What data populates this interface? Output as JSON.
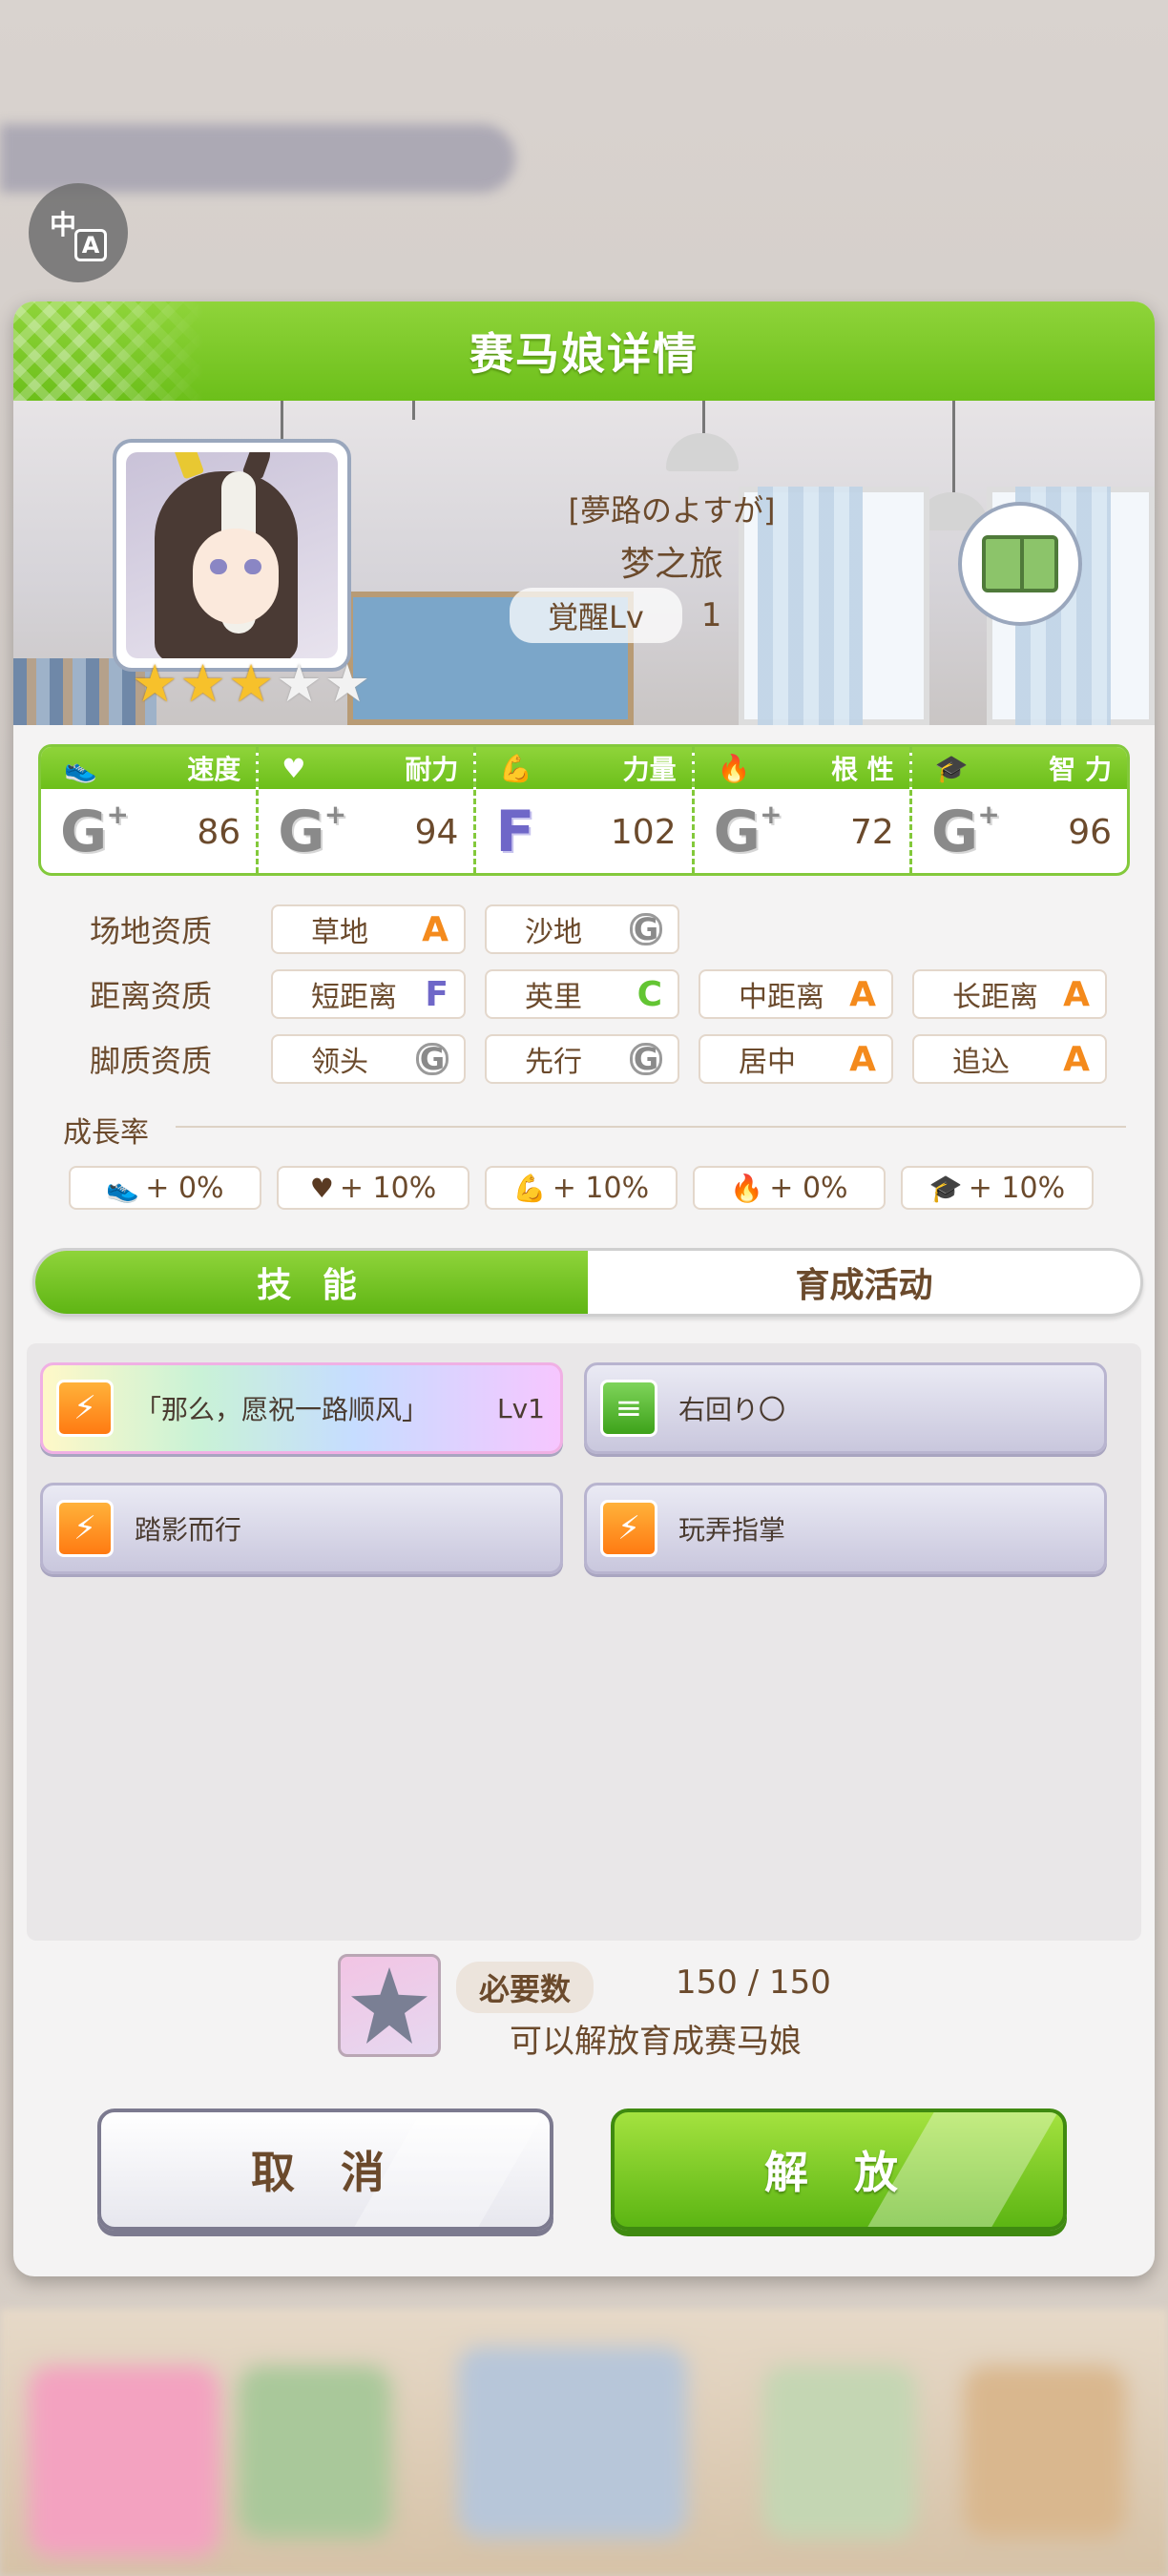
{
  "translate_button": {
    "char_a": "中",
    "char_b": "A"
  },
  "dialog": {
    "title": "赛马娘详情",
    "character": {
      "epithet": "[夢路のよすが]",
      "name": "梦之旅",
      "awakening_label": "覚醒Lv",
      "awakening_level": "1",
      "stars_filled": 3,
      "stars_total": 5
    },
    "stats": [
      {
        "label": "速度",
        "icon": "shoe-icon",
        "grade": "G",
        "value": "86"
      },
      {
        "label": "耐力",
        "icon": "heart-icon",
        "grade": "G",
        "value": "94"
      },
      {
        "label": "力量",
        "icon": "muscle-icon",
        "grade": "F",
        "value": "102"
      },
      {
        "label": "根 性",
        "icon": "fire-icon",
        "grade": "G",
        "value": "72"
      },
      {
        "label": "智 力",
        "icon": "graduation-cap-icon",
        "grade": "G",
        "value": "96"
      }
    ],
    "aptitude": {
      "track": {
        "label": "场地资质",
        "items": [
          {
            "name": "草地",
            "grade": "A"
          },
          {
            "name": "沙地",
            "grade": "G"
          }
        ]
      },
      "distance": {
        "label": "距离资质",
        "items": [
          {
            "name": "短距离",
            "grade": "F"
          },
          {
            "name": "英里",
            "grade": "C"
          },
          {
            "name": "中距离",
            "grade": "A"
          },
          {
            "name": "长距离",
            "grade": "A"
          }
        ]
      },
      "style": {
        "label": "脚质资质",
        "items": [
          {
            "name": "领头",
            "grade": "G"
          },
          {
            "name": "先行",
            "grade": "G"
          },
          {
            "name": "居中",
            "grade": "A"
          },
          {
            "name": "追込",
            "grade": "A"
          }
        ]
      }
    },
    "growth": {
      "title": "成長率",
      "items": [
        {
          "icon": "shoe-icon",
          "value": "+ 0%"
        },
        {
          "icon": "heart-icon",
          "value": "+ 10%"
        },
        {
          "icon": "muscle-icon",
          "value": "+ 10%"
        },
        {
          "icon": "fire-icon",
          "value": "+ 0%"
        },
        {
          "icon": "graduation-cap-icon",
          "value": "+ 10%"
        }
      ]
    },
    "tabs": {
      "skills": "技 能",
      "training": "育成活动"
    },
    "skills": [
      {
        "name": "「那么，愿祝一路顺风」",
        "level": "Lv1",
        "icon_color": "orange"
      },
      {
        "name": "右回り〇",
        "level": "",
        "icon_color": "green"
      },
      {
        "name": "踏影而行",
        "level": "",
        "icon_color": "orange"
      },
      {
        "name": "玩弄指掌",
        "level": "",
        "icon_color": "orange"
      }
    ],
    "unlock": {
      "required_label": "必要数",
      "required_value": "150 / 150",
      "message": "可以解放育成赛马娘"
    },
    "buttons": {
      "cancel": "取 消",
      "confirm": "解 放"
    }
  },
  "colors": {
    "accent_green": "#6cbf1a",
    "grade_a": "#f48a1c",
    "grade_c": "#63c533",
    "grade_f": "#6f67c8",
    "grade_g": "#8a8a8a",
    "text_brown": "#6b4a2c"
  }
}
